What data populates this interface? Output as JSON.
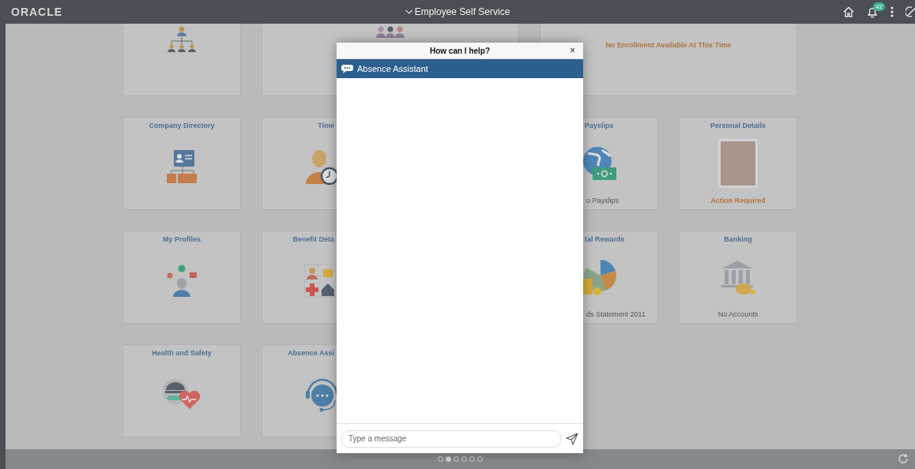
{
  "header": {
    "logo": "ORACLE",
    "title": "Employee Self Service",
    "notification_count": "42"
  },
  "rows": [
    {
      "left": [
        {
          "kind": "org-chart"
        },
        {
          "kind": "team",
          "wide": true
        }
      ],
      "right": [
        {
          "kind": "none",
          "wide": true,
          "status": {
            "text": "No Enrollment Available At This Time",
            "kind": "alert"
          }
        }
      ]
    },
    {
      "left": [
        {
          "title": "Company Directory",
          "kind": "directory"
        },
        {
          "title": "Time",
          "kind": "time"
        }
      ],
      "right": [
        {
          "title": "Payslips",
          "kind": "payslip",
          "status": {
            "text": "o Payslips",
            "kind": "info"
          }
        },
        {
          "title": "Personal Details",
          "kind": "photo",
          "status": {
            "text": "Action Required",
            "kind": "alert"
          }
        }
      ]
    },
    {
      "left": [
        {
          "title": "My Profiles",
          "kind": "profile"
        },
        {
          "title": "Benefit Deta",
          "kind": "benefits"
        }
      ],
      "right": [
        {
          "title": "tal Rewards",
          "kind": "rewards",
          "status": {
            "text": "ds Statement 2011",
            "kind": "info"
          }
        },
        {
          "title": "Banking",
          "kind": "bank",
          "status": {
            "text": "No Accounts",
            "kind": "info"
          }
        }
      ]
    },
    {
      "left": [
        {
          "title": "Health and Safety",
          "kind": "safety"
        },
        {
          "title": "Absence Assi",
          "kind": "headset"
        }
      ]
    }
  ],
  "dialog": {
    "title": "How can I help?",
    "close": "×",
    "assistant": "Absence Assistant",
    "input": {
      "placeholder": "Type a message"
    }
  },
  "pager": [
    {
      "selected": false
    },
    {
      "selected": true
    },
    {
      "selected": false
    },
    {
      "selected": false
    },
    {
      "selected": false
    },
    {
      "selected": false
    }
  ]
}
